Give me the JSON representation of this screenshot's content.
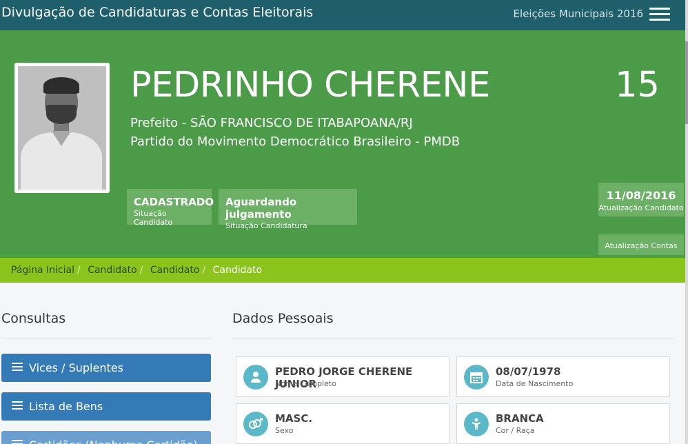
{
  "header": {
    "app_title": "Divulgação de Candidaturas e Contas Eleitorais",
    "election_label": "Eleições Municipais 2016",
    "menu_icon": "hamburger-icon"
  },
  "candidate": {
    "name": "PEDRINHO CHERENE",
    "number": "15",
    "role": "Prefeito - SÃO FRANCISCO DE ITABAPOANA/RJ",
    "party": "Partido do Movimento Democrático Brasileiro - PMDB",
    "status_candidate": {
      "value": "CADASTRADO",
      "label": "Situação Candidato"
    },
    "status_candidacy": {
      "value": "Aguardando julgamento",
      "label": "Situação Candidatura"
    },
    "update_candidate": {
      "value": "11/08/2016",
      "label": "Atualização Candidato"
    },
    "update_accounts": {
      "label": "Atualização Contas"
    }
  },
  "breadcrumb": {
    "items": [
      "Página Inicial",
      "Candidato",
      "Candidato"
    ],
    "current": "Candidato",
    "separator": "/"
  },
  "sidebar": {
    "title": "Consultas",
    "buttons": [
      {
        "label": "Vices / Suplentes",
        "icon": "list-icon"
      },
      {
        "label": "Lista de Bens",
        "icon": "list-icon"
      },
      {
        "label": "Certidões (Nenhuma Certidão)",
        "icon": "list-icon"
      }
    ]
  },
  "personal": {
    "title": "Dados Pessoais",
    "cards": [
      {
        "value": "PEDRO JORGE CHERENE JUNIOR",
        "label": "Nome Completo",
        "icon": "user-icon"
      },
      {
        "value": "08/07/1978",
        "label": "Data de Nascimento",
        "icon": "calendar-icon"
      },
      {
        "value": "MASC.",
        "label": "Sexo",
        "icon": "gender-icon"
      },
      {
        "value": "BRANCA",
        "label": "Cor / Raça",
        "icon": "person-icon"
      }
    ]
  },
  "colors": {
    "topbar": "#1f5f6b",
    "hero": "#4c9b48",
    "badge": "#6bb064",
    "breadcrumb": "#8cc41e",
    "button": "#337ab7",
    "icon_circle": "#5bb8c8"
  }
}
